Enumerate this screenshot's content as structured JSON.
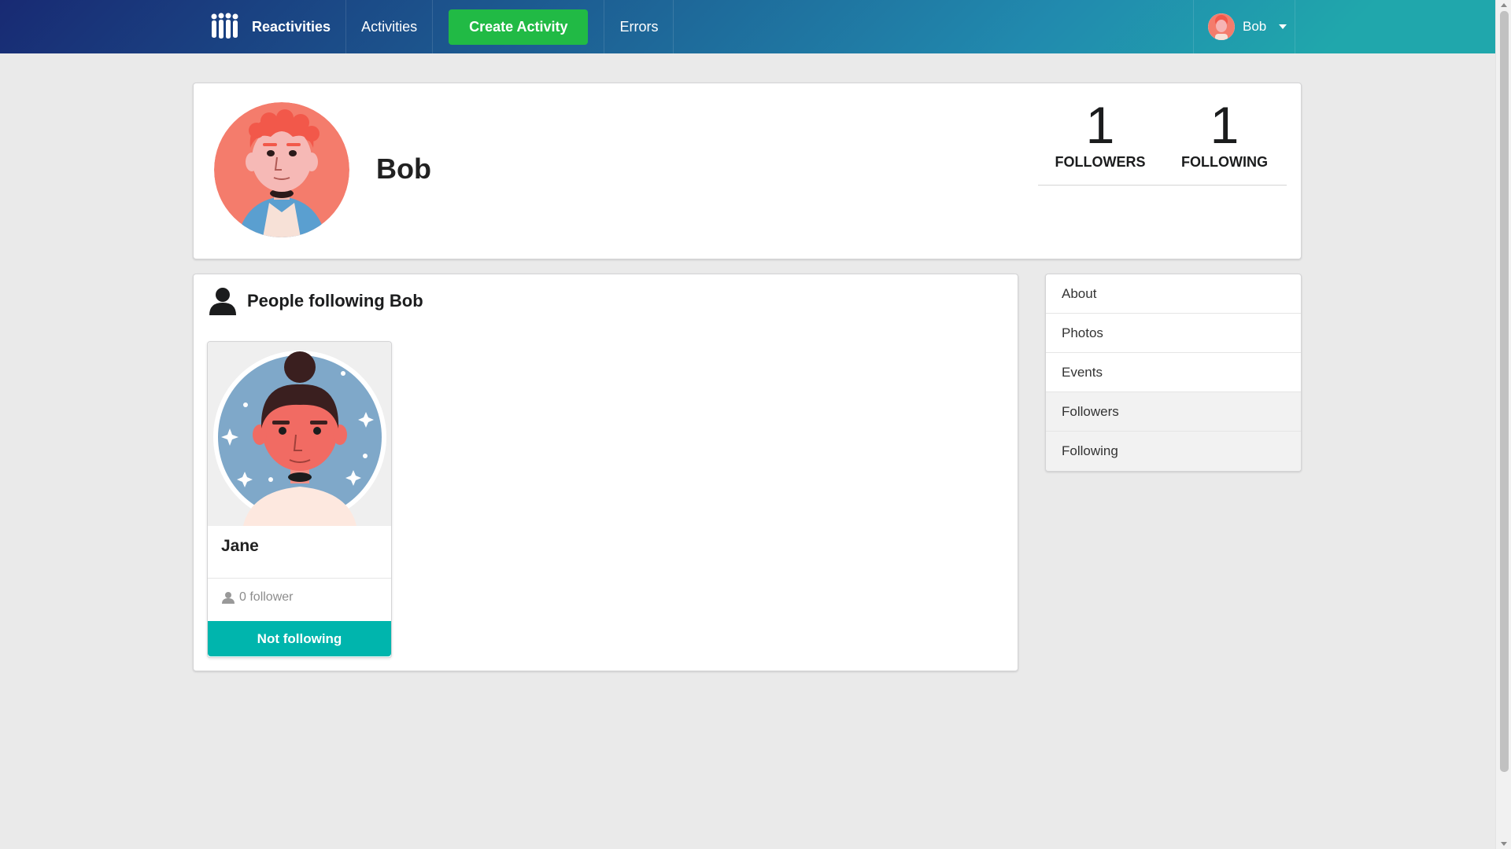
{
  "navbar": {
    "brand": "Reactivities",
    "activities": "Activities",
    "create_activity": "Create Activity",
    "errors": "Errors",
    "user_name": "Bob"
  },
  "profile": {
    "name": "Bob",
    "followers_count": "1",
    "followers_label": "FOLLOWERS",
    "following_count": "1",
    "following_label": "FOLLOWING"
  },
  "content": {
    "title": "People following Bob",
    "cards": [
      {
        "name": "Jane",
        "followers_text": "0 follower",
        "button_label": "Not following"
      }
    ]
  },
  "menu": {
    "items": [
      {
        "label": "About",
        "active": false
      },
      {
        "label": "Photos",
        "active": false
      },
      {
        "label": "Events",
        "active": false
      },
      {
        "label": "Followers",
        "active": true
      },
      {
        "label": "Following",
        "active": true
      }
    ]
  },
  "colors": {
    "nav_gradient_start": "#182a73",
    "nav_gradient_mid": "#218aae",
    "nav_gradient_end": "#20a7ac",
    "create_button": "#21ba45",
    "follow_button": "#00b5ad",
    "background": "#eaeaea"
  },
  "icons": {
    "brand": "reactivities-logo-icon",
    "header": "user-icon",
    "card_meta": "user-icon",
    "dropdown": "caret-down-icon"
  }
}
